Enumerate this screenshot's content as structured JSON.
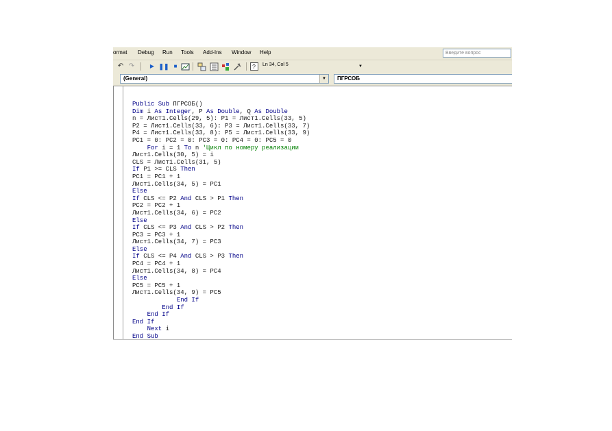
{
  "menu": [
    "ormat",
    "Debug",
    "Run",
    "Tools",
    "Add-Ins",
    "Window",
    "Help"
  ],
  "help_box_placeholder": "Введите вопрос",
  "toolbar": {
    "position": "Ln 34, Col 5",
    "icons": [
      "undo-icon",
      "redo-icon",
      "run-icon",
      "break-icon",
      "reset-icon",
      "design-mode-icon",
      "project-explorer-icon",
      "properties-icon",
      "object-browser-icon",
      "toolbox-icon",
      "help-icon"
    ]
  },
  "object_combo": "(General)",
  "proc_combo": "ПГРСОБ",
  "code": [
    [
      {
        "t": "Public Sub ",
        "k": "kw"
      },
      {
        "t": "ПГРСОБ()"
      }
    ],
    [
      {
        "t": "Dim ",
        "k": "kw"
      },
      {
        "t": "i "
      },
      {
        "t": "As Integer",
        "k": "kw"
      },
      {
        "t": ", P "
      },
      {
        "t": "As Double",
        "k": "kw"
      },
      {
        "t": ", Q "
      },
      {
        "t": "As Double",
        "k": "kw"
      }
    ],
    [
      {
        "t": "n = Лист1.Cells(29, 5): P1 = Лист1.Cells(33, 5)"
      }
    ],
    [
      {
        "t": "P2 = Лист1.Cells(33, 6): P3 = Лист1.Cells(33, 7)"
      }
    ],
    [
      {
        "t": "P4 = Лист1.Cells(33, 8): P5 = Лист1.Cells(33, 9)"
      }
    ],
    [
      {
        "t": "PC1 = 0: PC2 = 0: PC3 = 0: PC4 = 0: PC5 = 0"
      }
    ],
    [
      {
        "t": "    "
      },
      {
        "t": "For ",
        "k": "kw"
      },
      {
        "t": "i = 1 "
      },
      {
        "t": "To ",
        "k": "kw"
      },
      {
        "t": "n "
      },
      {
        "t": "'Цикл по номеру реализации",
        "k": "cm"
      }
    ],
    [
      {
        "t": "Лист1.Cells(30, 5) = i"
      }
    ],
    [
      {
        "t": "CLS = Лист1.Cells(31, 5)"
      }
    ],
    [
      {
        "t": "If ",
        "k": "kw"
      },
      {
        "t": "P1 >= CLS "
      },
      {
        "t": "Then",
        "k": "kw"
      }
    ],
    [
      {
        "t": "PC1 = PC1 + 1"
      }
    ],
    [
      {
        "t": "Лист1.Cells(34, 5) = PC1"
      }
    ],
    [
      {
        "t": "Else",
        "k": "kw"
      }
    ],
    [
      {
        "t": "If ",
        "k": "kw"
      },
      {
        "t": "CLS <= P2 "
      },
      {
        "t": "And ",
        "k": "kw"
      },
      {
        "t": "CLS > P1 "
      },
      {
        "t": "Then",
        "k": "kw"
      }
    ],
    [
      {
        "t": "PC2 = PC2 + 1"
      }
    ],
    [
      {
        "t": "Лист1.Cells(34, 6) = PC2"
      }
    ],
    [
      {
        "t": "Else",
        "k": "kw"
      }
    ],
    [
      {
        "t": "If ",
        "k": "kw"
      },
      {
        "t": "CLS <= P3 "
      },
      {
        "t": "And ",
        "k": "kw"
      },
      {
        "t": "CLS > P2 "
      },
      {
        "t": "Then",
        "k": "kw"
      }
    ],
    [
      {
        "t": "PC3 = PC3 + 1"
      }
    ],
    [
      {
        "t": "Лист1.Cells(34, 7) = PC3"
      }
    ],
    [
      {
        "t": "Else",
        "k": "kw"
      }
    ],
    [
      {
        "t": "If ",
        "k": "kw"
      },
      {
        "t": "CLS <= P4 "
      },
      {
        "t": "And ",
        "k": "kw"
      },
      {
        "t": "CLS > P3 "
      },
      {
        "t": "Then",
        "k": "kw"
      }
    ],
    [
      {
        "t": "PC4 = PC4 + 1"
      }
    ],
    [
      {
        "t": "Лист1.Cells(34, 8) = PC4"
      }
    ],
    [
      {
        "t": "Else",
        "k": "kw"
      }
    ],
    [
      {
        "t": "PC5 = PC5 + 1"
      }
    ],
    [
      {
        "t": "Лист1.Cells(34, 9) = PC5"
      }
    ],
    [
      {
        "t": "            "
      },
      {
        "t": "End If",
        "k": "kw"
      }
    ],
    [
      {
        "t": "        "
      },
      {
        "t": "End If",
        "k": "kw"
      }
    ],
    [
      {
        "t": "    "
      },
      {
        "t": "End If",
        "k": "kw"
      }
    ],
    [
      {
        "t": "End If",
        "k": "kw"
      }
    ],
    [
      {
        "t": "    "
      },
      {
        "t": "Next ",
        "k": "kw"
      },
      {
        "t": "i"
      }
    ],
    [
      {
        "t": "End Sub",
        "k": "kw"
      }
    ]
  ]
}
